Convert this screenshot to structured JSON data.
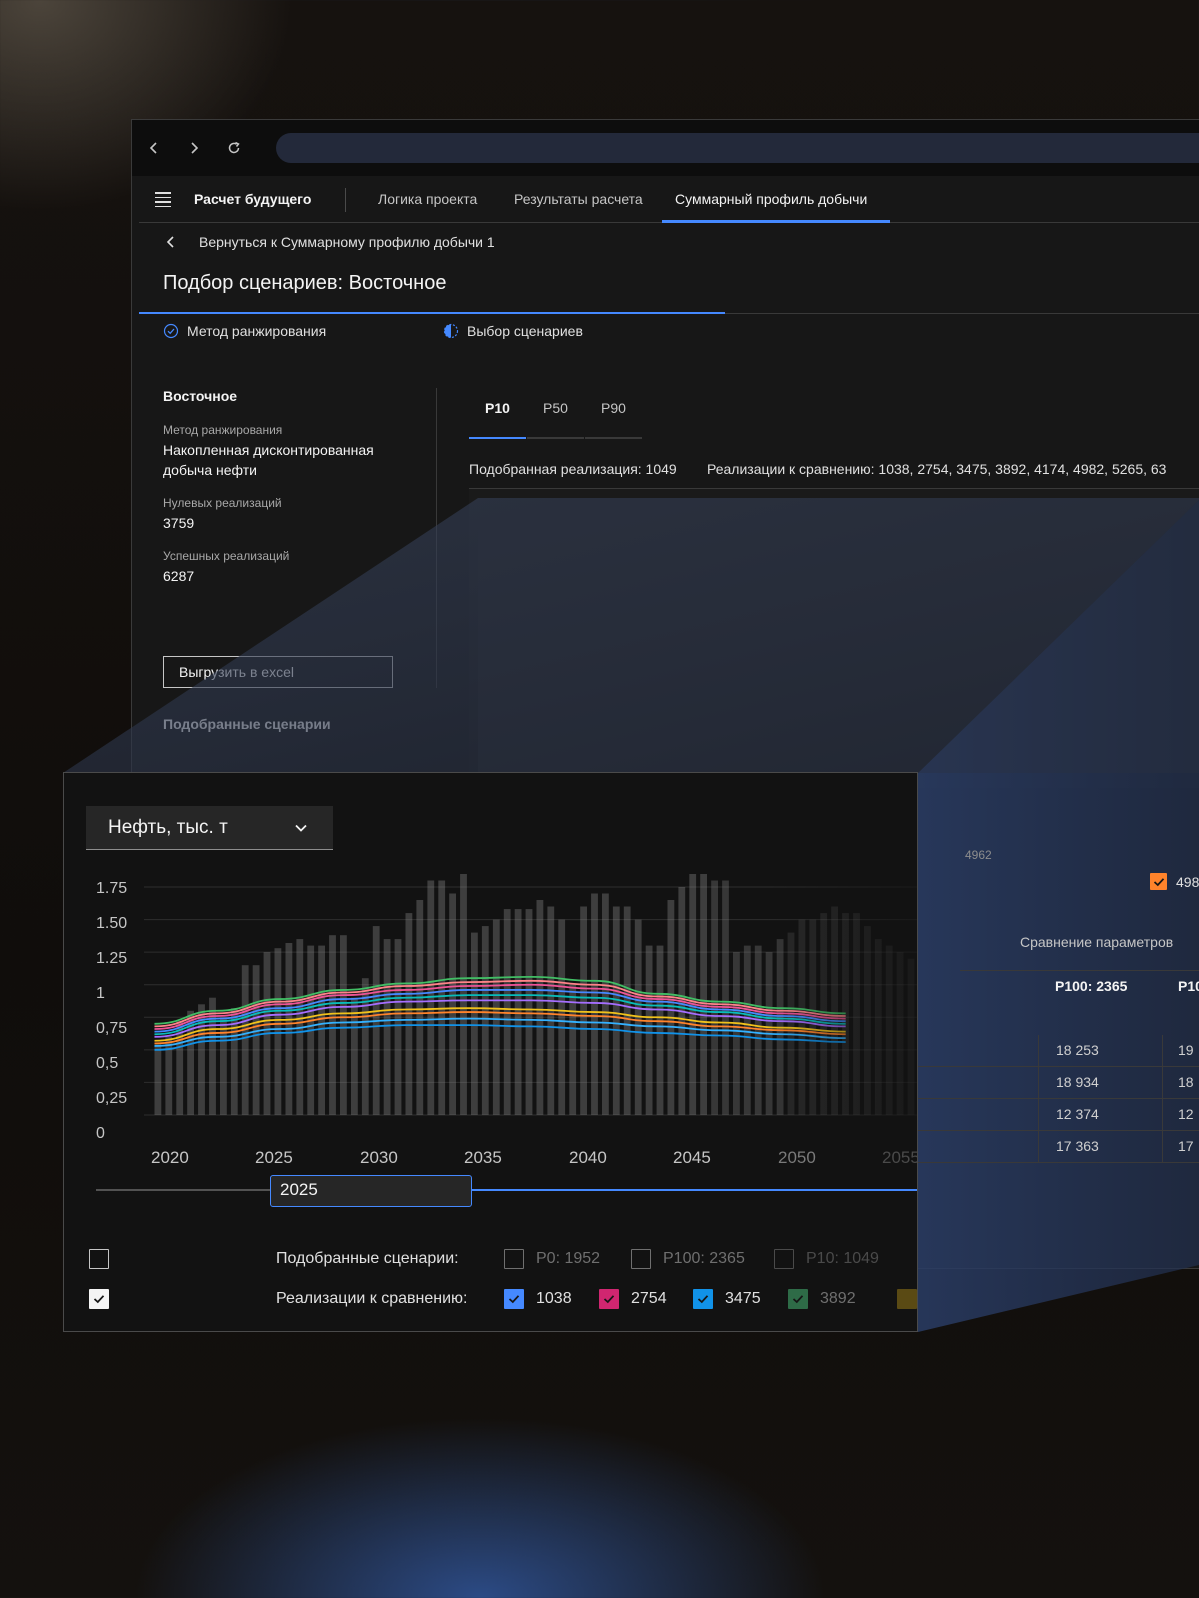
{
  "browser": {
    "back": "back",
    "forward": "forward",
    "reload": "reload"
  },
  "app": {
    "name": "Расчет будущего",
    "tabs": [
      {
        "label": "Логика проекта",
        "active": false
      },
      {
        "label": "Результаты расчета",
        "active": false
      },
      {
        "label": "Суммарный профиль добычи",
        "active": true
      }
    ],
    "back_link": "Вернуться к Суммарному профилю добычи 1",
    "page_title": "Подбор сценариев: Восточное",
    "steps": [
      {
        "label": "Метод ранжирования",
        "state": "complete"
      },
      {
        "label": "Выбор сценариев",
        "state": "current"
      }
    ]
  },
  "sidebar": {
    "title": "Восточное",
    "method_label": "Метод ранжирования",
    "method_value": "Накопленная дисконтированная добыча нефти",
    "zero_label": "Нулевых реализаций",
    "zero_value": "3759",
    "success_label": "Успешных реализаций",
    "success_value": "6287",
    "export_button": "Выгрузить в excel",
    "subsection": "Подобранные сценарии"
  },
  "main": {
    "p_tabs": [
      "P10",
      "P50",
      "P90"
    ],
    "selected": "Подобранная реализация: 1049",
    "compare": "Реализации к сравнению: 1038, 2754, 3475, 3892, 4174, 4982, 5265, 63"
  },
  "table": {
    "header_1": "P100: 2365",
    "header_2": "P10",
    "params_label": "Сравнение параметров",
    "rows": [
      [
        "18 253",
        "19"
      ],
      [
        "18 934",
        "18"
      ],
      [
        "12 374",
        "12"
      ],
      [
        "17 363",
        "17"
      ]
    ],
    "right_legend": "498",
    "right_legend_small": "4962"
  },
  "zoom": {
    "select_value": "Нефть, тыс. т",
    "slider_value": "2025",
    "row1_label": "Подобранные сценарии:",
    "row2_label": "Реализации к сравнению:",
    "scenarios": [
      {
        "label": "P0: 1952",
        "checked": false
      },
      {
        "label": "P100: 2365",
        "checked": false
      },
      {
        "label": "P10: 1049",
        "checked": false
      }
    ],
    "realizations": [
      {
        "label": "1038",
        "color": "#4589ff",
        "checked": true
      },
      {
        "label": "2754",
        "color": "#d02670",
        "checked": true
      },
      {
        "label": "3475",
        "color": "#1192e8",
        "checked": true
      },
      {
        "label": "3892",
        "color": "#2e6b47",
        "checked": true
      }
    ]
  },
  "chart_data": {
    "type": "line",
    "title": "",
    "xlabel": "",
    "ylabel": "",
    "ylim": [
      0,
      1.75
    ],
    "yticks": [
      "1.75",
      "1.50",
      "1.25",
      "1",
      "0,75",
      "0,5",
      "0,25",
      "0"
    ],
    "xticks": [
      "2020",
      "2025",
      "2030",
      "2035",
      "2040",
      "2045",
      "2050",
      "2055"
    ],
    "x": [
      2020,
      2023,
      2026,
      2029,
      2032,
      2035,
      2038,
      2041,
      2044,
      2047,
      2050,
      2053
    ],
    "series": [
      {
        "color": "#42be65",
        "values": [
          0.7,
          0.8,
          0.89,
          0.96,
          1.01,
          1.05,
          1.06,
          1.03,
          0.93,
          0.87,
          0.82,
          0.78
        ]
      },
      {
        "color": "#ff8389",
        "values": [
          0.68,
          0.78,
          0.87,
          0.94,
          0.99,
          1.02,
          1.03,
          1.0,
          0.91,
          0.85,
          0.8,
          0.76
        ]
      },
      {
        "color": "#ee5396",
        "values": [
          0.66,
          0.76,
          0.85,
          0.92,
          0.96,
          0.99,
          1.0,
          0.97,
          0.89,
          0.83,
          0.78,
          0.74
        ]
      },
      {
        "color": "#4589ff",
        "values": [
          0.64,
          0.74,
          0.82,
          0.89,
          0.93,
          0.96,
          0.96,
          0.94,
          0.87,
          0.81,
          0.76,
          0.72
        ]
      },
      {
        "color": "#08bdba",
        "values": [
          0.62,
          0.72,
          0.8,
          0.86,
          0.9,
          0.92,
          0.92,
          0.9,
          0.84,
          0.79,
          0.74,
          0.7
        ]
      },
      {
        "color": "#a56eff",
        "values": [
          0.6,
          0.69,
          0.77,
          0.83,
          0.87,
          0.88,
          0.88,
          0.86,
          0.81,
          0.76,
          0.72,
          0.68
        ]
      },
      {
        "color": "#f1c21b",
        "values": [
          0.57,
          0.66,
          0.73,
          0.78,
          0.81,
          0.82,
          0.81,
          0.79,
          0.75,
          0.71,
          0.67,
          0.64
        ]
      },
      {
        "color": "#ff832b",
        "values": [
          0.55,
          0.63,
          0.7,
          0.75,
          0.78,
          0.79,
          0.78,
          0.76,
          0.72,
          0.68,
          0.65,
          0.62
        ]
      },
      {
        "color": "#33b1ff",
        "values": [
          0.53,
          0.6,
          0.66,
          0.71,
          0.73,
          0.74,
          0.73,
          0.71,
          0.68,
          0.65,
          0.62,
          0.59
        ]
      },
      {
        "color": "#1192e8",
        "values": [
          0.5,
          0.57,
          0.63,
          0.67,
          0.69,
          0.69,
          0.68,
          0.66,
          0.63,
          0.61,
          0.58,
          0.56
        ]
      }
    ],
    "bars": {
      "x_start": 2020,
      "x_end": 2057,
      "values": [
        0.55,
        0.6,
        0.72,
        0.8,
        0.85,
        0.9,
        0.75,
        0.82,
        1.15,
        1.15,
        1.25,
        1.28,
        1.32,
        1.35,
        1.3,
        1.3,
        1.38,
        1.38,
        0.9,
        1.05,
        1.45,
        1.35,
        1.35,
        1.55,
        1.65,
        1.8,
        1.8,
        1.7,
        1.85,
        1.4,
        1.45,
        1.5,
        1.58,
        1.58,
        1.58,
        1.65,
        1.6,
        1.5,
        1.0,
        1.6,
        1.7,
        1.7,
        1.6,
        1.6,
        1.5,
        1.3,
        1.3,
        1.65,
        1.75,
        1.85,
        1.85,
        1.8,
        1.8,
        1.25,
        1.3,
        1.3,
        1.25,
        1.35,
        1.4,
        1.5,
        1.5,
        1.55,
        1.6,
        1.55,
        1.55,
        1.45,
        1.35,
        1.3,
        1.25,
        1.2,
        1.2
      ]
    }
  }
}
